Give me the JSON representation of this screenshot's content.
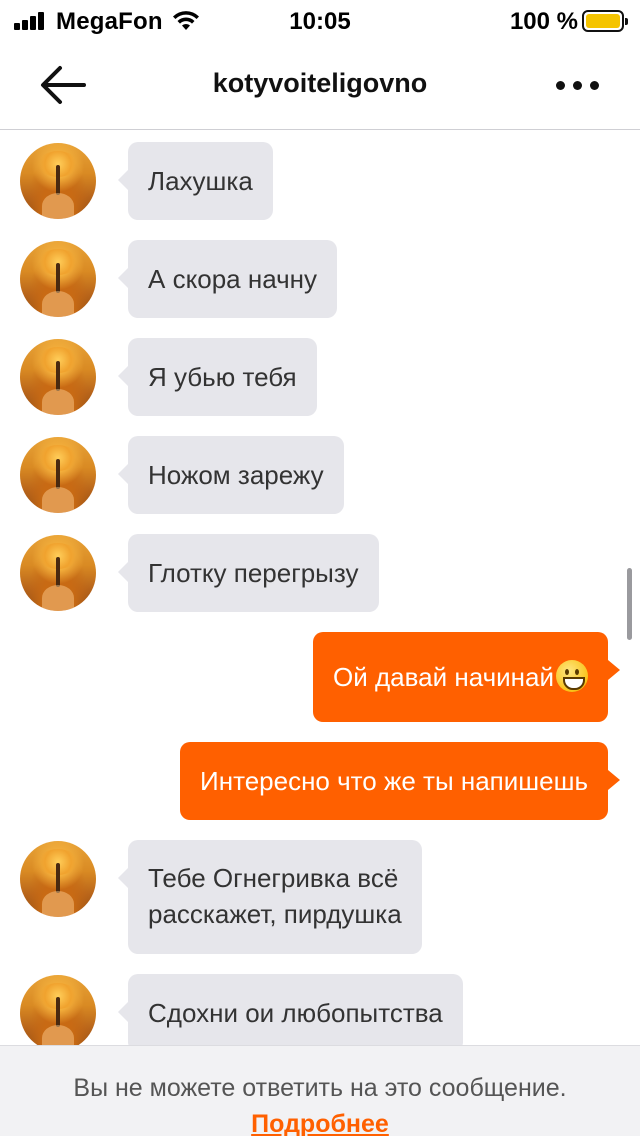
{
  "status_bar": {
    "carrier": "MegaFon",
    "time": "10:05",
    "battery_percent": "100 %",
    "battery_level": 1.0,
    "battery_color": "#f5c400"
  },
  "header": {
    "title": "kotyvoiteligovno",
    "back_icon": "arrow-left-icon",
    "more_icon": "more-dots-icon"
  },
  "messages": [
    {
      "direction": "in",
      "text": "Лахушка"
    },
    {
      "direction": "in",
      "text": "А скора начну"
    },
    {
      "direction": "in",
      "text": "Я убью тебя"
    },
    {
      "direction": "in",
      "text": "Ножом зарежу"
    },
    {
      "direction": "in",
      "text": "Глотку перегрызу"
    },
    {
      "direction": "out",
      "text": "Ой давай начинай",
      "emoji": "grinning-face-emoji"
    },
    {
      "direction": "out",
      "text": "Интересно что же ты напишешь"
    },
    {
      "direction": "in",
      "text_line1": "Тебе Огнегривка всё",
      "text_line2": "расскажет, пирдушка"
    },
    {
      "direction": "in",
      "text": "Сдохни ои любопытства"
    }
  ],
  "footer": {
    "notice": "Вы не можете ответить на это сообщение.",
    "link": "Подробнее"
  },
  "colors": {
    "accent": "#ff6000",
    "incoming_bubble": "#e6e6eb",
    "outgoing_bubble": "#ff6000"
  }
}
